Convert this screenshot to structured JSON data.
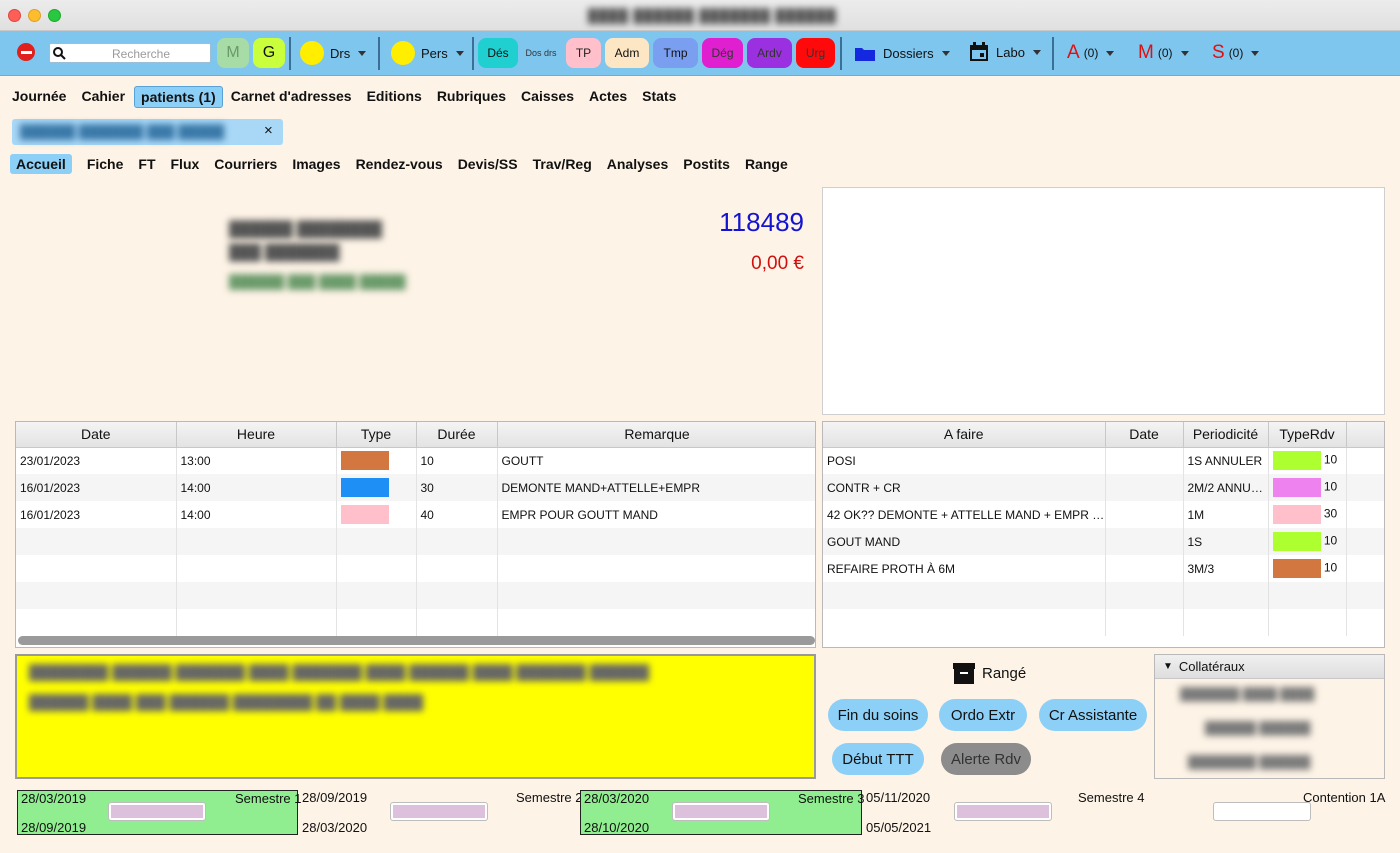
{
  "window": {
    "title": "████ ██████ ███████ ██████"
  },
  "toolbar": {
    "search_placeholder": "Recherche",
    "m": "M",
    "g": "G",
    "drs": "Drs",
    "pers": "Pers",
    "des": "Dés",
    "dosdrs": "Dos drs",
    "tp": "TP",
    "adm": "Adm",
    "tmp": "Tmp",
    "deg": "Dég",
    "ardv": "Ardv",
    "urg": "Urg",
    "dossiers": "Dossiers",
    "labo": "Labo",
    "a": "A",
    "a_count": "(0)",
    "m2": "M",
    "m_count": "(0)",
    "s": "S",
    "s_count": "(0)"
  },
  "menu": [
    "Journée",
    "Cahier",
    "patients (1)",
    "Carnet d'adresses",
    "Editions",
    "Rubriques",
    "Caisses",
    "Actes",
    "Stats"
  ],
  "patient_tab": {
    "label": "██████ ███████ ███ █████"
  },
  "subtabs": [
    "Accueil",
    "Fiche",
    "FT",
    "Flux",
    "Courriers",
    "Images",
    "Rendez-vous",
    "Devis/SS",
    "Trav/Reg",
    "Analyses",
    "Postits",
    "Range"
  ],
  "patient": {
    "name": "██████ ████████",
    "address": "███ ███████",
    "phone": "██████ ███ ████ █████",
    "id": "118489",
    "balance": "0,00 €"
  },
  "rdv_table": {
    "headers": [
      "Date",
      "Heure",
      "Type",
      "Durée",
      "Remarque"
    ],
    "rows": [
      {
        "date": "23/01/2023",
        "heure": "13:00",
        "color": "#d2773f",
        "duree": "10",
        "remarque": "GOUTT"
      },
      {
        "date": "16/01/2023",
        "heure": "14:00",
        "color": "#1e8ff5",
        "duree": "30",
        "remarque": "DEMONTE MAND+ATTELLE+EMPR"
      },
      {
        "date": "16/01/2023",
        "heure": "14:00",
        "color": "#ffc0cb",
        "duree": "40",
        "remarque": "EMPR POUR GOUTT MAND"
      }
    ]
  },
  "todo_table": {
    "headers": [
      "A faire",
      "Date",
      "Periodicité",
      "TypeRdv"
    ],
    "rows": [
      {
        "afaire": "POSI",
        "date": "",
        "period": "1S ANNULER",
        "color": "#adff2f",
        "type": "10"
      },
      {
        "afaire": "CONTR + CR",
        "date": "",
        "period": "2M/2 ANNU…",
        "color": "#ee82ee",
        "type": "10"
      },
      {
        "afaire": "42 OK?? DEMONTE + ATTELLE MAND + EMPR …",
        "date": "",
        "period": "1M",
        "color": "#ffc0cb",
        "type": "30"
      },
      {
        "afaire": "GOUT MAND",
        "date": "",
        "period": "1S",
        "color": "#adff2f",
        "type": "10"
      },
      {
        "afaire": "REFAIRE PROTH À 6M",
        "date": "",
        "period": "3M/3",
        "color": "#d2773f",
        "type": "10"
      }
    ]
  },
  "notes": {
    "line1": "████████ ██████ ███████ ████ ███████ ████ ██████ ████ ███████ ██████",
    "line2": "██████ ████ ███ ██████ ████████ ██ ████ ████"
  },
  "actions": {
    "range": "Rangé",
    "fin": "Fin du soins",
    "ordo": "Ordo Extr",
    "cr": "Cr Assistante",
    "debut": "Début TTT",
    "alerte": "Alerte Rdv"
  },
  "collateraux": {
    "title": "Collatéraux",
    "items": [
      "███████ ████ ████",
      "██████ ██████",
      "████████ ██████"
    ]
  },
  "semestres": [
    {
      "start": "28/03/2019",
      "end": "28/09/2019",
      "label": "Semestre 1"
    },
    {
      "start": "28/09/2019",
      "end": "28/03/2020",
      "label": "Semestre 2"
    },
    {
      "start": "28/03/2020",
      "end": "28/10/2020",
      "label": "Semestre 3"
    },
    {
      "start": "05/11/2020",
      "end": "05/05/2021",
      "label": "Semestre 4"
    },
    {
      "label": "Contention 1A"
    }
  ]
}
